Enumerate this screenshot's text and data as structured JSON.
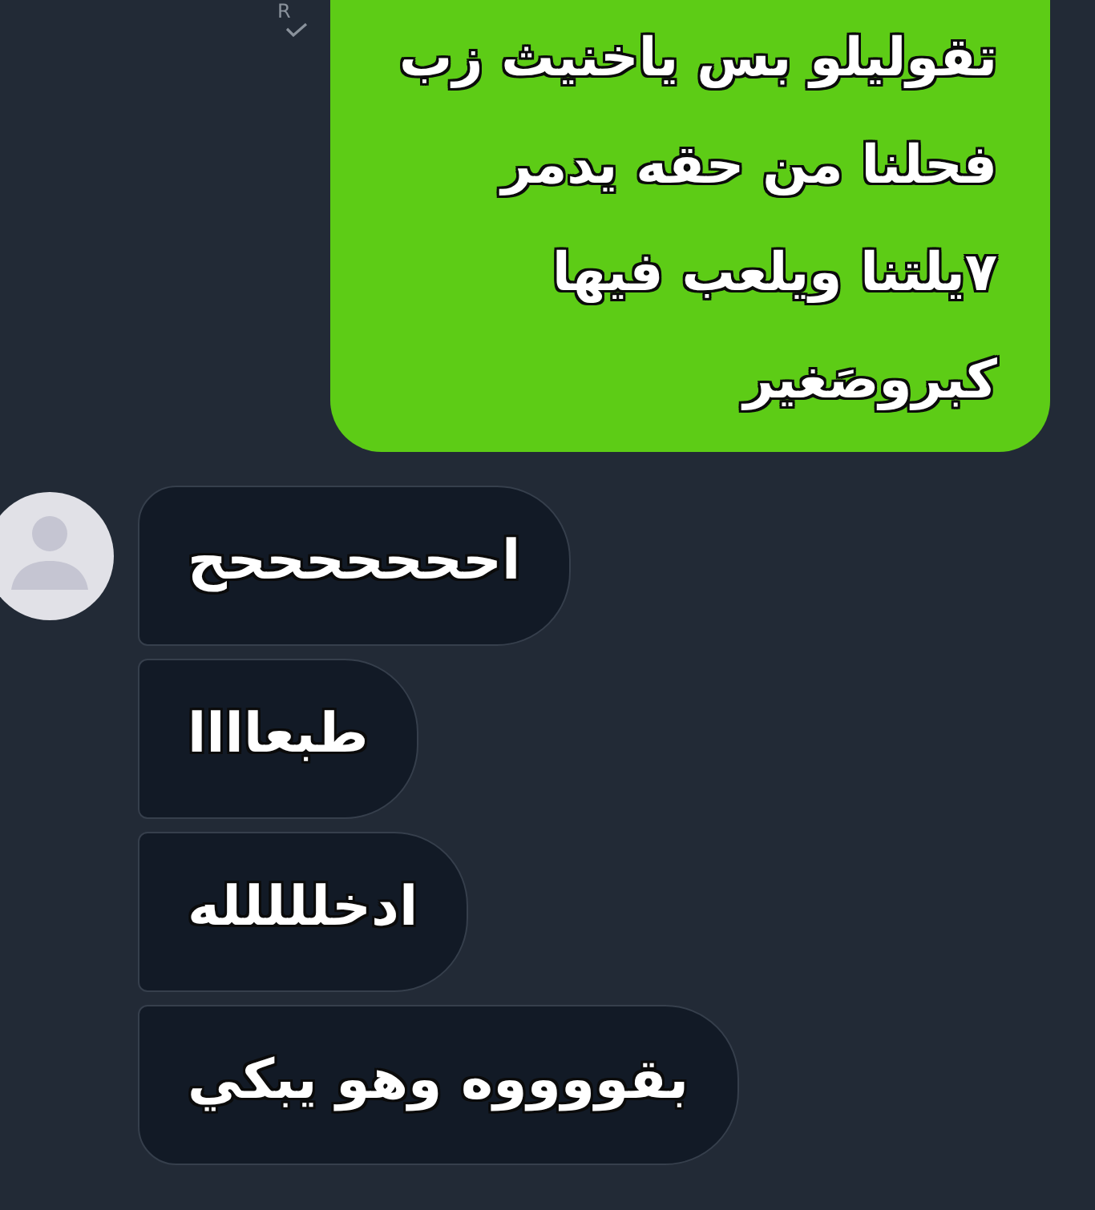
{
  "outgoing": {
    "read_receipt": {
      "label": "R",
      "read": true
    },
    "text": "تقوليلو بس ياخنيث زب\nفحلنا من حقه يدمر\n٧يلتنا ويلعب فيها\nكبروصَغير"
  },
  "incoming": {
    "messages": [
      {
        "text": "احححححححح"
      },
      {
        "text": "طبعاااا"
      },
      {
        "text": "ادخللللله"
      },
      {
        "text": "بقووووه وهو يبكي"
      }
    ]
  }
}
